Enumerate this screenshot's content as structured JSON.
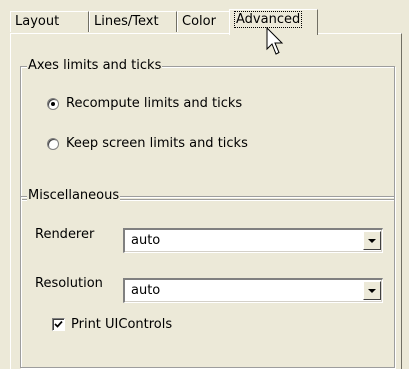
{
  "tabs": [
    "Layout",
    "Lines/Text",
    "Color",
    "Advanced"
  ],
  "axes_group": {
    "title": "Axes limits and ticks",
    "options": [
      {
        "label": "Recompute limits and ticks",
        "checked": true
      },
      {
        "label": "Keep screen limits and ticks",
        "checked": false
      }
    ]
  },
  "misc_group": {
    "title": "Miscellaneous",
    "renderer": {
      "label": "Renderer",
      "value": "auto"
    },
    "resolution": {
      "label": "Resolution",
      "value": "auto"
    },
    "print_uicontrols": {
      "label": "Print UIControls",
      "checked": true
    }
  }
}
